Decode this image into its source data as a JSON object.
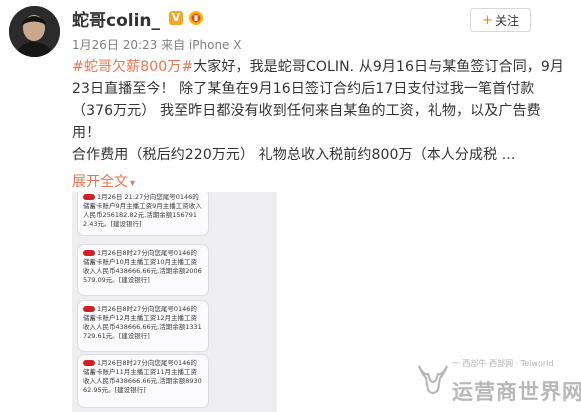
{
  "user": {
    "name": "蛇哥colin_",
    "vip_badge": "V",
    "follow_label": "关注",
    "follow_plus": "+"
  },
  "post": {
    "meta": "1月26日 20:23 来自 iPhone X",
    "hashtag": "#蛇哥欠薪800万#",
    "lines": [
      "大家好，我是蛇哥COLIN.    从9月16日与某鱼签订合同，9月",
      "23日直播至今！      除了某鱼在9月16日签订合约后17日支付过我一笔首付款",
      "（376万元）      我至昨日都没有收到任何来自某鱼的工资，礼物，以及广告费",
      "用！",
      "    合作费用（税后约220万元）  礼物总收入税前约800万（本人分成税 ..."
    ],
    "expand_label": "展开全文",
    "expand_arrow": "▾"
  },
  "sms_image": {
    "messages": [
      "1月26日 21:27分向您尾号0146的储蓄卡账户9月主播工资9月主播工资收入人民币256182.82元,活期余额1567912.43元。[建设银行]",
      "1月26日8时27分向您尾号0146的储蓄卡账户10月主播工资10月主播工资收入人民币438666.66元,活期余额2006579.09元。[建设银行]",
      "1月26日8时27分向您尾号0146的储蓄卡账户12月主播工资12月主播工资收入人民币438666.66元,活期余额1331729.61元。[建设银行]",
      "1月26日8时27分向您尾号0146的储蓄卡账户11月主播工资11月主播工资收入人民币438666.66元,活期余额893062.95元。[建设银行]"
    ]
  },
  "watermark": {
    "small_text": "一 西部牛 西部网 · Telworld",
    "big_text": "运营商世界网"
  },
  "colors": {
    "accent": "#eb7350",
    "follow_plus": "#ff8200",
    "vip": "#f5a623"
  }
}
